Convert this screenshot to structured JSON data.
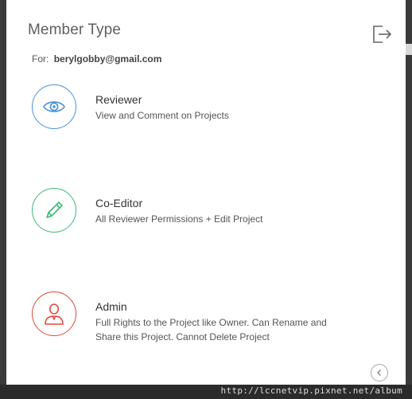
{
  "dialog": {
    "title": "Member Type",
    "for_label": "For:",
    "email": "berylgobby@gmail.com"
  },
  "roles": [
    {
      "name": "Reviewer",
      "description": "View and Comment on Projects",
      "icon": "eye-icon",
      "color": "#4a90d9"
    },
    {
      "name": "Co-Editor",
      "description": "All Reviewer Permissions + Edit Project",
      "icon": "pencil-icon",
      "color": "#3cb878"
    },
    {
      "name": "Admin",
      "description": "Full Rights to the Project like Owner. Can Rename and Share this Project. Cannot Delete Project",
      "icon": "person-icon",
      "color": "#e04b3c"
    }
  ],
  "icons": {
    "exit": "exit-icon",
    "back": "back-arrow-icon"
  },
  "watermark": "http://lccnetvip.pixnet.net/album"
}
